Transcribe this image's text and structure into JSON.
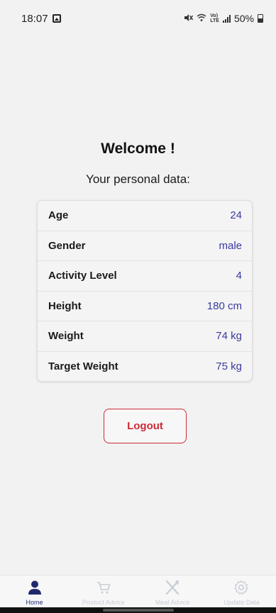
{
  "status_bar": {
    "time": "18:07",
    "net_label": "Vo)\nLTE",
    "battery": "50%"
  },
  "main": {
    "title": "Welcome !",
    "subtitle": "Your personal data:",
    "rows": [
      {
        "label": "Age",
        "value": "24"
      },
      {
        "label": "Gender",
        "value": "male"
      },
      {
        "label": "Activity Level",
        "value": "4"
      },
      {
        "label": "Height",
        "value": "180 cm"
      },
      {
        "label": "Weight",
        "value": "74 kg"
      },
      {
        "label": "Target Weight",
        "value": "75 kg"
      }
    ],
    "logout_label": "Logout"
  },
  "nav": {
    "items": [
      {
        "label": "Home",
        "icon": "person-icon",
        "active": true
      },
      {
        "label": "Product Advice",
        "icon": "cart-icon",
        "active": false
      },
      {
        "label": "Meal Advice",
        "icon": "utensils-icon",
        "active": false
      },
      {
        "label": "Update Data",
        "icon": "gear-icon",
        "active": false
      }
    ]
  },
  "colors": {
    "value_text": "#3a3aa0",
    "logout_red": "#cc2a36",
    "nav_active": "#1f2a6e",
    "nav_inactive": "#c8cdd6"
  }
}
